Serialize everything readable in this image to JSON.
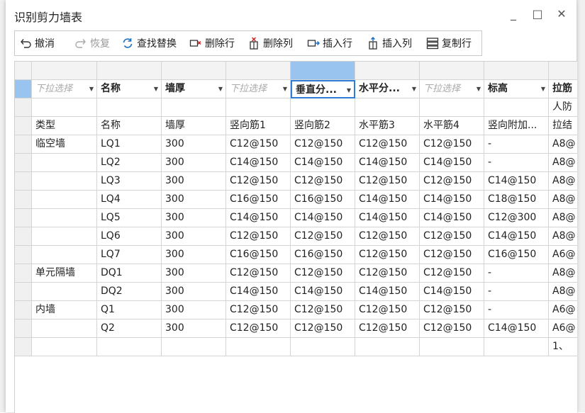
{
  "dialog": {
    "title": "识别剪力墙表"
  },
  "window_controls": {
    "minimize": "_",
    "maximize": "□",
    "close": "✕"
  },
  "toolbar": [
    {
      "name": "undo-button",
      "icon": "undo-icon",
      "label": "撤消",
      "enabled": true
    },
    {
      "name": "redo-button",
      "icon": "redo-icon",
      "label": "恢复",
      "enabled": false
    },
    {
      "name": "find-replace-button",
      "icon": "refresh-icon",
      "label": "查找替换",
      "enabled": true
    },
    {
      "name": "delete-row-button",
      "icon": "delete-row-icon",
      "label": "删除行",
      "enabled": true
    },
    {
      "name": "delete-column-button",
      "icon": "delete-column-icon",
      "label": "删除列",
      "enabled": true
    },
    {
      "name": "insert-row-button",
      "icon": "insert-row-icon",
      "label": "插入行",
      "enabled": true
    },
    {
      "name": "insert-column-button",
      "icon": "insert-column-icon",
      "label": "插入列",
      "enabled": true
    },
    {
      "name": "copy-row-button",
      "icon": "copy-row-icon",
      "label": "复制行",
      "enabled": true
    }
  ],
  "table": {
    "dropdown_headers": [
      {
        "text": "下拉选择",
        "placeholder": true
      },
      {
        "text": "名称",
        "placeholder": false
      },
      {
        "text": "墙厚",
        "placeholder": false
      },
      {
        "text": "下拉选择",
        "placeholder": true
      },
      {
        "text": "垂直分...",
        "placeholder": false,
        "selected": true
      },
      {
        "text": "水平分...",
        "placeholder": false
      },
      {
        "text": "下拉选择",
        "placeholder": true
      },
      {
        "text": "标高",
        "placeholder": false
      },
      {
        "text": "拉筋",
        "placeholder": false
      }
    ],
    "rows": [
      [
        "",
        "",
        "",
        "",
        "",
        "",
        "",
        "",
        "人防"
      ],
      [
        "类型",
        "名称",
        "墙厚",
        "竖向筋1",
        "竖向筋2",
        "水平筋3",
        "水平筋4",
        "竖向附加...",
        "拉结"
      ],
      [
        "临空墙",
        "LQ1",
        "300",
        "C12@150",
        "C12@150",
        "C12@150",
        "C12@150",
        "-",
        "A8@"
      ],
      [
        "",
        "LQ2",
        "300",
        "C14@150",
        "C14@150",
        "C14@150",
        "C14@150",
        "-",
        "A8@"
      ],
      [
        "",
        "LQ3",
        "300",
        "C12@150",
        "C12@150",
        "C12@150",
        "C12@150",
        "C14@150",
        "A8@"
      ],
      [
        "",
        "LQ4",
        "300",
        "C16@150",
        "C16@150",
        "C14@150",
        "C14@150",
        "C18@150",
        "A8@"
      ],
      [
        "",
        "LQ5",
        "300",
        "C14@150",
        "C14@150",
        "C14@150",
        "C14@150",
        "C12@300",
        "A8@"
      ],
      [
        "",
        "LQ6",
        "300",
        "C12@150",
        "C12@150",
        "C12@150",
        "C12@150",
        "C14@150",
        "A8@"
      ],
      [
        "",
        "LQ7",
        "300",
        "C16@150",
        "C16@150",
        "C12@150",
        "C12@150",
        "C16@150",
        "A6@"
      ],
      [
        "单元隔墙",
        "DQ1",
        "300",
        "C12@150",
        "C12@150",
        "C12@150",
        "C12@150",
        "-",
        "A8@"
      ],
      [
        "",
        "DQ2",
        "300",
        "C14@150",
        "C14@150",
        "C14@150",
        "C14@150",
        "-",
        "A8@"
      ],
      [
        "内墙",
        "Q1",
        "300",
        "C12@150",
        "C12@150",
        "C12@150",
        "C12@150",
        "-",
        "A6@"
      ],
      [
        "",
        "Q2",
        "300",
        "C12@150",
        "C12@150",
        "C12@150",
        "C12@150",
        "C14@150",
        "A6@"
      ],
      [
        "",
        "",
        "",
        "",
        "",
        "",
        "",
        "",
        "1、"
      ]
    ]
  },
  "colors": {
    "selection": "#99c4f0",
    "focus_border": "#2f7dd6",
    "header_bg": "#f3f3f3"
  }
}
